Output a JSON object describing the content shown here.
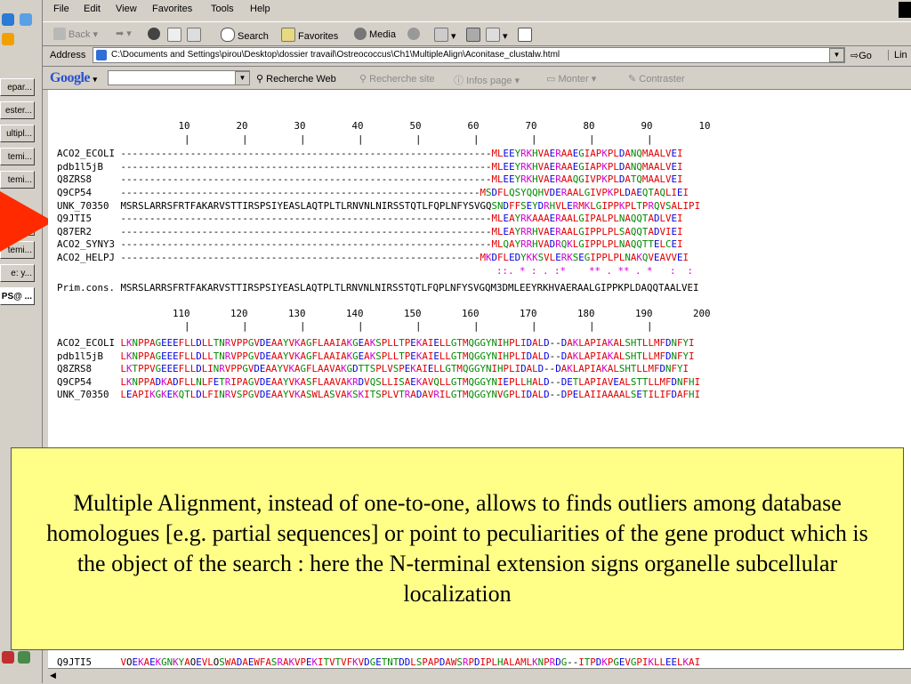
{
  "menu": [
    "File",
    "Edit",
    "View",
    "Favorites",
    "Tools",
    "Help"
  ],
  "toolbar": {
    "back": "Back",
    "search": "Search",
    "favorites": "Favorites",
    "media": "Media"
  },
  "address": {
    "label": "Address",
    "url": "C:\\Documents and Settings\\pirou\\Desktop\\dossier travail\\Ostreococcus\\Ch1\\MultipleAlign\\Aconitase_clustalw.html",
    "go": "Go",
    "links": "Lin"
  },
  "google": {
    "logo": "Google",
    "search_web": "Recherche Web",
    "search_site": "Recherche site",
    "page_info": "Infos page",
    "up": "Monter",
    "highlight": "Contraster"
  },
  "taskbar": [
    "epar...",
    "ester...",
    "ultipl...",
    "temi...",
    "temi...",
    "temi...",
    "temi...",
    "e: y...",
    "PS@ ..."
  ],
  "alignment": {
    "block1_ruler": "          10        20        30        40        50        60        70        80        90        10",
    "block1_ticks": "           |         |         |         |         |         |         |         |         |",
    "block1": [
      {
        "name": "ACO2_ECOLI",
        "seq": "----------------------------------------------------------------MLEEYRKHVAERAAEGIAPKPLDANQMAALVEI"
      },
      {
        "name": "pdb1l5jB",
        "seq": "----------------------------------------------------------------MLEEYRKHVAERAAEGIAPKPLDANQMAALVEI"
      },
      {
        "name": "Q8ZRS8",
        "seq": "----------------------------------------------------------------MLEEYRKHVAERAAQGIVPKPLDATQMAALVEI"
      },
      {
        "name": "Q9CP54",
        "seq": "--------------------------------------------------------------MSDFLQSYQQHVDERAALGIVPKPLDAEQTAQLIEI"
      },
      {
        "name": "UNK_70350",
        "seq": "MSRSLARRSFRTFAKARVSTTIRSPSIYEASLAQTPLTLRNVNLNIRSSTQTLFQPLNFYSVGQSNDFFSEYDRHVLERMKLGIPPKPLTPRQVSALIPI"
      },
      {
        "name": "Q9JTI5",
        "seq": "----------------------------------------------------------------MLEAYRKAAAERAALGIPALPLNAQQTADLVEI"
      },
      {
        "name": "Q87ER2",
        "seq": "----------------------------------------------------------------MLEAYRRHVAERAALGIPPLPLSAQQTADVIEI"
      },
      {
        "name": "ACO2_SYNY3",
        "seq": "----------------------------------------------------------------MLQAYRRHVADRQKLGIPPLPLNAQQTTELCEI"
      },
      {
        "name": "ACO2_HELPJ",
        "seq": "--------------------------------------------------------------MKDFLEDYKKSVLERKSEGIPPLPLNAKQVEAVVEI"
      }
    ],
    "block1_cons": "                                                                 ::. * : . :*    ** . ** . *   :  :",
    "block1_prim_label": "Prim.cons.",
    "block1_prim": "MSRSLARRSFRTFAKARVSTTIRSPSIYEASLAQTPLTLRNVNLNIRSSTQTLFQPLNFYSVGQM3DMLEEYRKHVAERAALGIPPKPLDAQQTAALVEI",
    "block2_ruler": "         110       120       130       140       150       160       170       180       190       200",
    "block2_ticks": "           |         |         |         |         |         |         |         |         |",
    "block2": [
      {
        "name": "ACO2_ECOLI",
        "seq": "LKNPPAGEEEFLLDLLTNRVPPGVDEAAYVKAGFLAAIAKGEAKSPLLTPEKAIELLGTMQGGYNIHPLIDALD--DAKLAPIAKALSHTLLMFDNFYI"
      },
      {
        "name": "pdb1l5jB",
        "seq": "LKNPPAGEEEFLLDLLTNRVPPGVDEAAYVKAGFLAAIAKGEAKSPLLTPEKAIELLGTMQGGYNIHPLIDALD--DAKLAPIAKALSHTLLMFDNFYI"
      },
      {
        "name": "Q8ZRS8",
        "seq": "LKTPPVGEEEFLLDLINRVPPGVDEAAYVKAGFLAAVAKGDTTSPLVSPEKAIELLGTMQGGYNIHPLIDALD--DAKLAPIAKALSHTLLMFDNFYI"
      },
      {
        "name": "Q9CP54",
        "seq": "LKNPPADKADFLLNLFETRIPAGVDEAAYVKASFLAAVAKRDVQSLLISAEKAVQLLGTMQGGYNIEPLLHALD--DETLAPIAVEALSTTLLMFDNFHI"
      },
      {
        "name": "UNK_70350",
        "seq": "LEAPIKGKEKQTLDLFINRVSPGVDEAAYVKASWLASVAKSKITSPLVTRADAVRILGTMQGGYNVGPLIDALD--DPELAIIAAAALSETILIFDAFHI"
      }
    ],
    "bottom_row": {
      "name": "Q9JTI5",
      "seq": "VOEKAEKGNKYAOEVLOSWADAEWFASRAKVPEKITVTVFKVDGETNTDDLSPAPDAWSRPDIPLHALAMLKNPRDG--ITPDKPGEVGPIKLLEELKAI"
    }
  },
  "overlay": {
    "text": "Multiple Alignment, instead of one-to-one, allows to finds outliers among database homologues [e.g. partial sequences] or point to peculiarities of the gene product which is the object of the search : here the N-terminal extension signs organelle subcellular localization"
  },
  "colors": {
    "overlay_bg": "#ffff88",
    "arrow": "#ff2a00",
    "hydrophobic": "#e00000",
    "acidic": "#0000e0",
    "basic": "#d000d0",
    "polar": "#008800"
  }
}
